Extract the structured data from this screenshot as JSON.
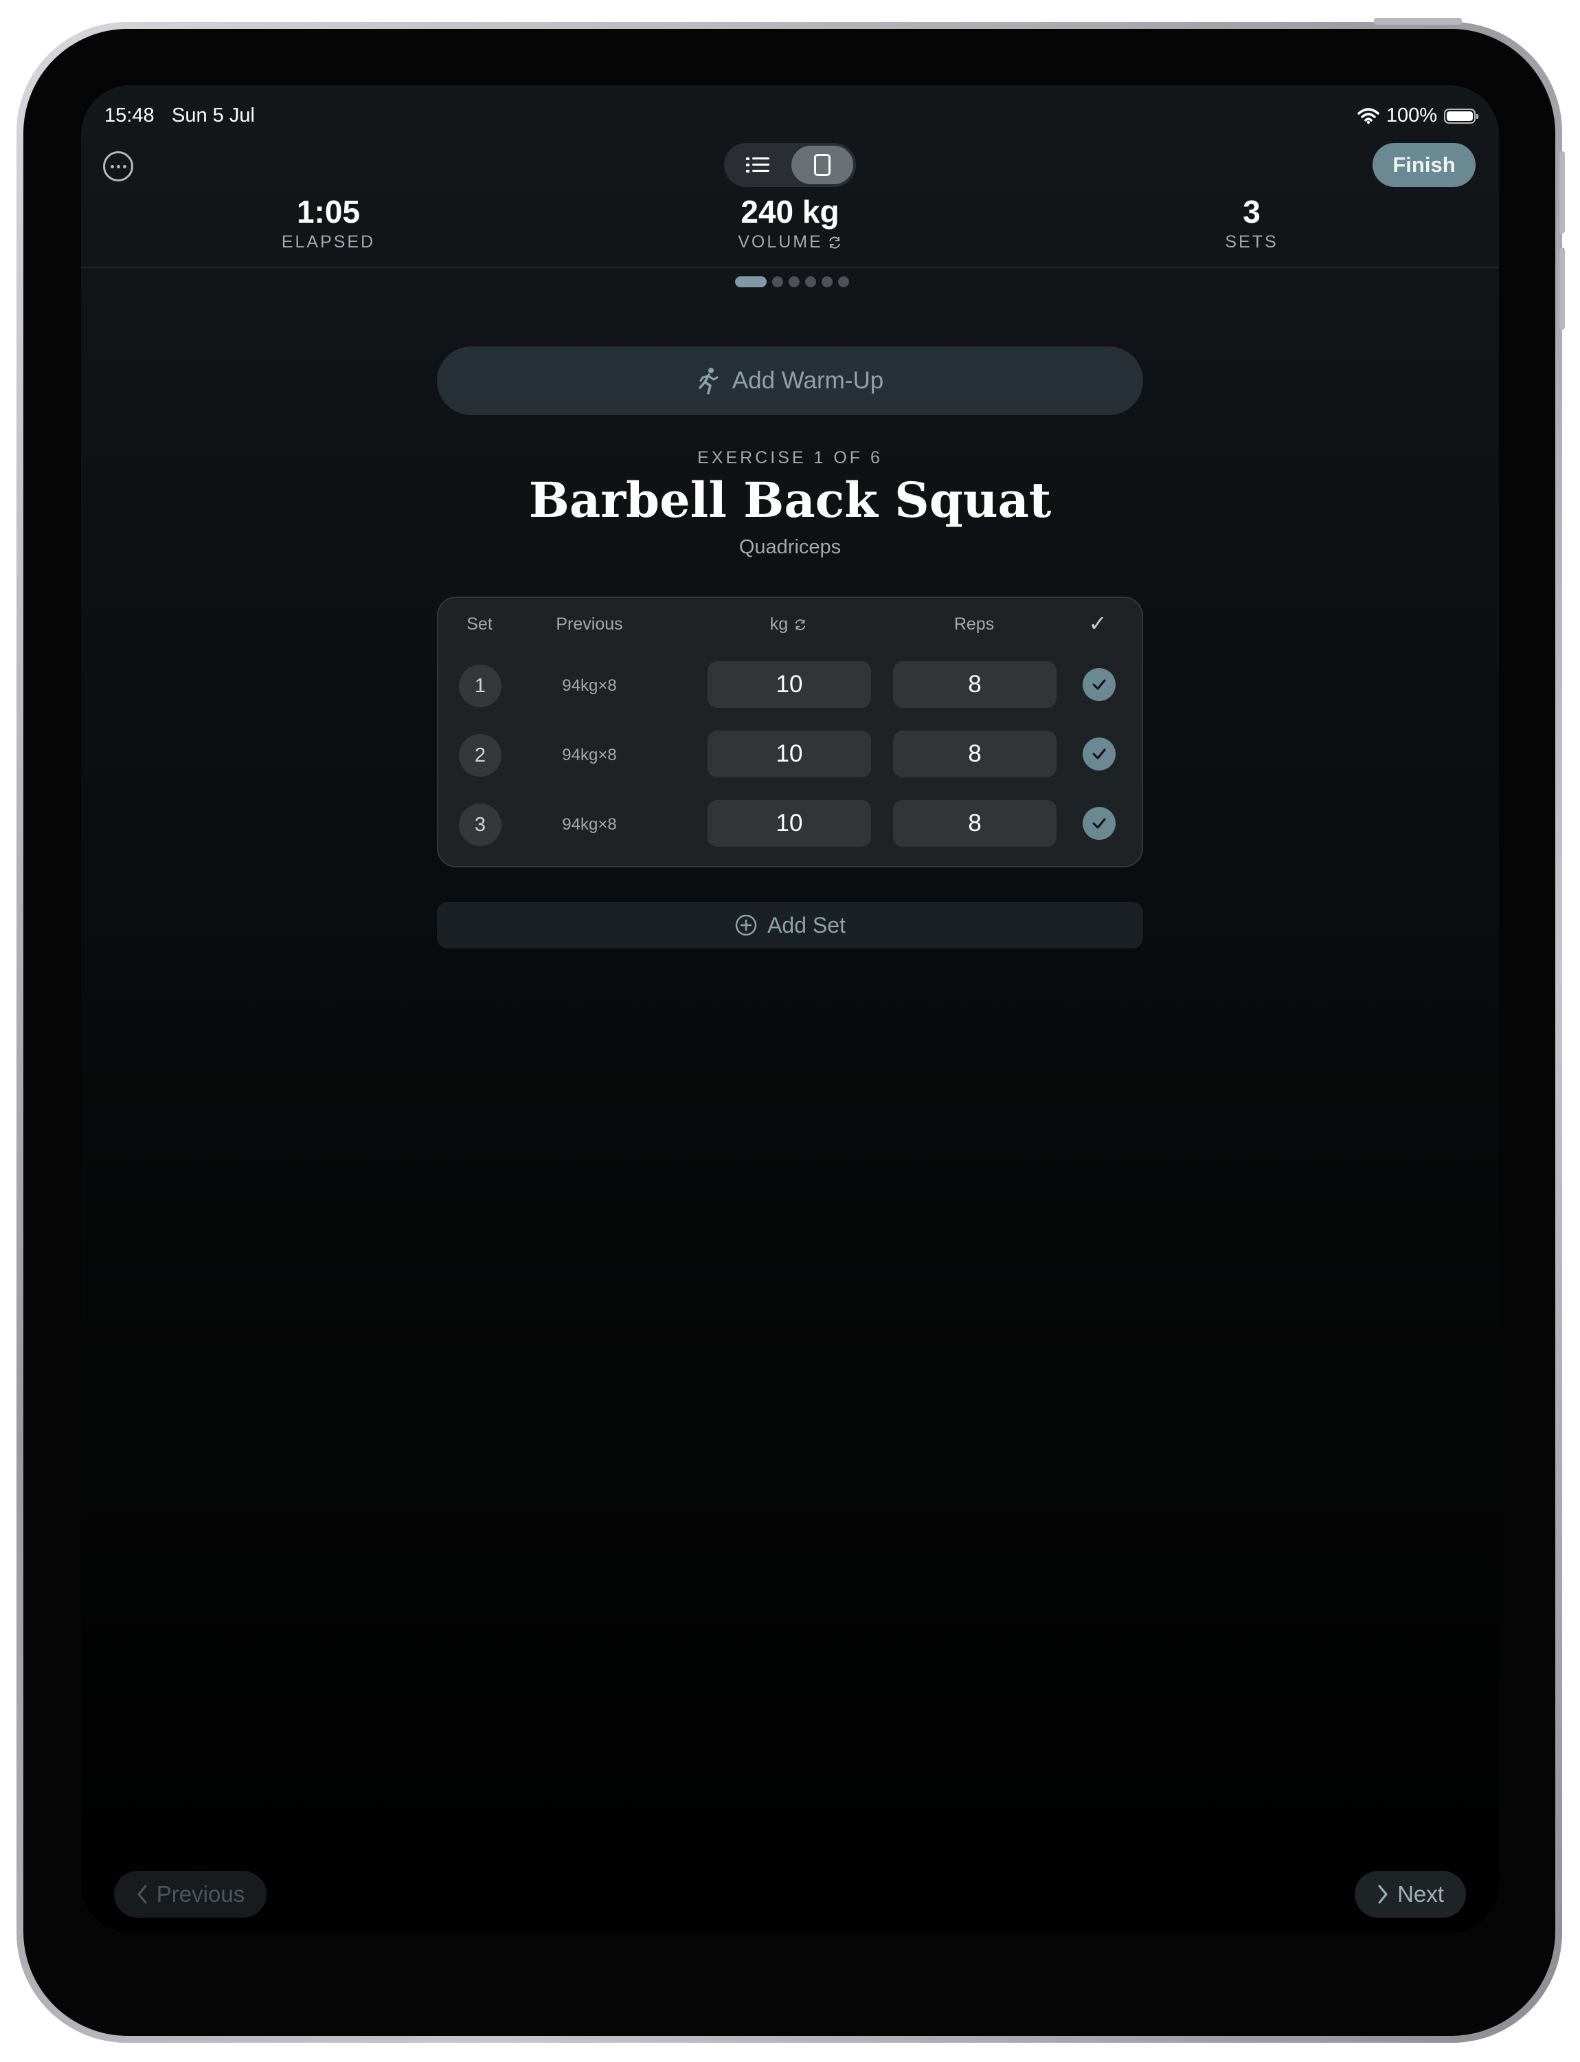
{
  "status_bar": {
    "time": "15:48",
    "date": "Sun 5 Jul",
    "battery": "100%"
  },
  "header": {
    "finish_label": "Finish",
    "view_modes": [
      "list",
      "card"
    ],
    "selected_view": "card"
  },
  "stats": {
    "elapsed": {
      "value": "1:05",
      "label": "ELAPSED"
    },
    "volume": {
      "value": "240 kg",
      "label": "VOLUME"
    },
    "sets": {
      "value": "3",
      "label": "SETS"
    }
  },
  "pager": {
    "total": 6,
    "current": 1
  },
  "warmup": {
    "label": "Add Warm-Up"
  },
  "exercise": {
    "count": "EXERCISE 1 OF 6",
    "name": "Barbell Back Squat",
    "muscle": "Quadriceps"
  },
  "table": {
    "headers": {
      "set": "Set",
      "previous": "Previous",
      "kg": "kg",
      "reps": "Reps",
      "done": "✓"
    },
    "rows": [
      {
        "set": "1",
        "previous": "94kg×8",
        "kg": "10",
        "reps": "8",
        "completed": true
      },
      {
        "set": "2",
        "previous": "94kg×8",
        "kg": "10",
        "reps": "8",
        "completed": true
      },
      {
        "set": "3",
        "previous": "94kg×8",
        "kg": "10",
        "reps": "8",
        "completed": true
      }
    ]
  },
  "add_set": {
    "label": "Add Set"
  },
  "nav": {
    "previous": "Previous",
    "next": "Next"
  },
  "colors": {
    "accent": "#6a8993",
    "accent_text": "#8fa2aa",
    "card": "#1f2224",
    "background": "#0d0f11"
  }
}
